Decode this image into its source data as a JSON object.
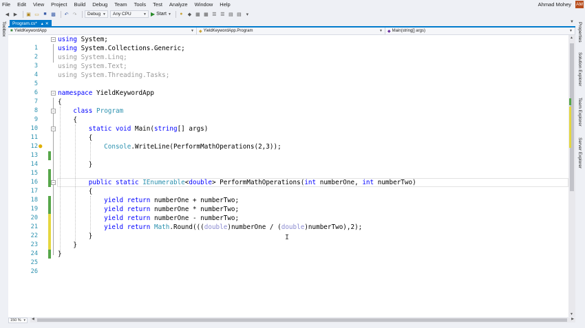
{
  "menu": [
    "File",
    "Edit",
    "View",
    "Project",
    "Build",
    "Debug",
    "Team",
    "Tools",
    "Test",
    "Analyze",
    "Window",
    "Help"
  ],
  "user": {
    "name": "Ahmad Mohey",
    "initials": "AM"
  },
  "toolbar": {
    "config": "Debug",
    "platform": "Any CPU",
    "start_label": "Start"
  },
  "side": {
    "toolbox": "Toolbox",
    "right_tabs": [
      "Properties",
      "Solution Explorer",
      "Team Explorer",
      "Server Explorer"
    ]
  },
  "tab": {
    "label": "Program.cs*"
  },
  "nav": {
    "project": "YieldKeywordApp",
    "class": "YieldKeywordApp.Program",
    "member": "Main(string[] args)"
  },
  "zoom": "150 %",
  "code": {
    "lines": [
      "1",
      "2",
      "3",
      "4",
      "5",
      "6",
      "7",
      "8",
      "9",
      "10",
      "11",
      "12",
      "13",
      "14",
      "15",
      "16",
      "17",
      "18",
      "19",
      "20",
      "21",
      "22",
      "23",
      "24",
      "25",
      "26"
    ],
    "using1": "System",
    "using2": "System.Collections.Generic",
    "using3": "System.Linq",
    "using4": "System.Text",
    "using5": "System.Threading.Tasks",
    "namespace_name": "YieldKeywordApp",
    "class_name": "Program",
    "main_name": "Main",
    "main_params": "args",
    "console": "Console",
    "writeline_call": "WriteLine(PerformMathOperations(2,3));",
    "ienumerable": "IEnumerable",
    "method_name": "PerformMathOperations(",
    "param1": "numberOne,",
    "param2": "numberTwo)",
    "yield1": "numberOne + numberTwo;",
    "yield2": "numberOne * numberTwo;",
    "yield3": "numberOne - numberTwo;",
    "math": "Math",
    "round_a": ".Round(((",
    "round_b": "numberOne / (",
    "round_c": "numberTwo),2);"
  }
}
